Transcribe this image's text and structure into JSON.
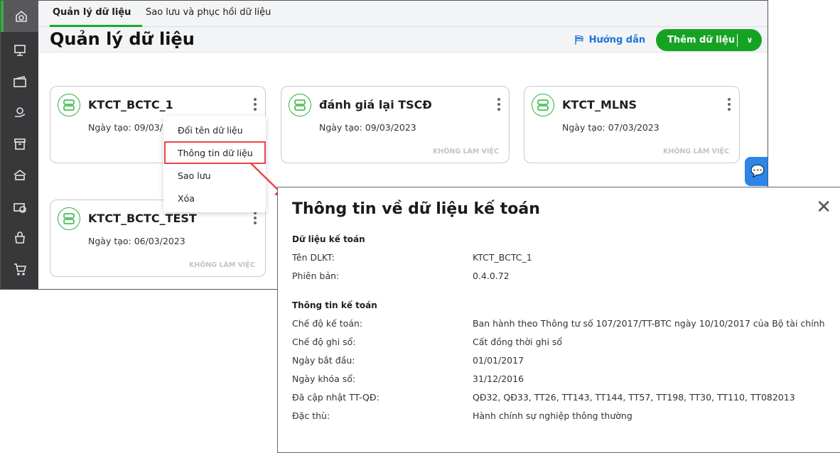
{
  "sidebar": {
    "items": [
      {
        "icon": "home-icon",
        "active": true
      },
      {
        "icon": "monitor-money-icon"
      },
      {
        "icon": "wallet-icon"
      },
      {
        "icon": "hand-money-icon"
      },
      {
        "icon": "box-icon"
      },
      {
        "icon": "car-icon"
      },
      {
        "icon": "briefcase-money-icon"
      },
      {
        "icon": "bag-icon"
      },
      {
        "icon": "cart-icon"
      }
    ]
  },
  "tabs": [
    {
      "label": "Quản lý dữ liệu",
      "active": true
    },
    {
      "label": "Sao lưu và phục hồi dữ liệu"
    }
  ],
  "header": {
    "title": "Quản lý dữ liệu",
    "guide": "Hướng dẫn",
    "add": "Thêm dữ liệu"
  },
  "cards": [
    {
      "name": "KTCT_BCTC_1",
      "date": "Ngày tạo: 09/03/2023",
      "status": ""
    },
    {
      "name": "đánh giá lại TSCĐ",
      "date": "Ngày tạo: 09/03/2023",
      "status": "KHÔNG LÀM VIỆC"
    },
    {
      "name": "KTCT_MLNS",
      "date": "Ngày tạo: 07/03/2023",
      "status": "KHÔNG LÀM VIỆC"
    },
    {
      "name": "KTCT_BCTC_TEST",
      "date": "Ngày tạo: 06/03/2023",
      "status": "KHÔNG LÀM VIỆC"
    }
  ],
  "menu": [
    "Đổi tên dữ liệu",
    "Thông tin dữ liệu",
    "Sao lưu",
    "Xóa"
  ],
  "colors": {
    "accent": "#16a323",
    "highlight": "#ee4444",
    "link": "#1e73d8",
    "sidebar": "#38383b"
  },
  "dialog": {
    "title": "Thông tin về dữ liệu kế toán",
    "sec1": "Dữ liệu kế toán",
    "rows1": [
      {
        "label": "Tên DLKT:",
        "value": "KTCT_BCTC_1"
      },
      {
        "label": "Phiên bản:",
        "value": "0.4.0.72"
      }
    ],
    "sec2": "Thông tin kế toán",
    "rows2": [
      {
        "label": "Chế độ kế toán:",
        "value": "Ban hành theo Thông tư số 107/2017/TT-BTC ngày 10/10/2017 của Bộ tài chính"
      },
      {
        "label": "Chế độ ghi sổ:",
        "value": "Cất đồng thời ghi sổ"
      },
      {
        "label": "Ngày bắt đầu:",
        "value": "01/01/2017"
      },
      {
        "label": "Ngày khóa sổ:",
        "value": "31/12/2016"
      },
      {
        "label": "Đã cập nhật TT-QĐ:",
        "value": "QĐ32, QĐ33, TT26, TT143, TT144, TT57, TT198, TT30, TT110, TT082013"
      },
      {
        "label": "Đặc thù:",
        "value": "Hành chính sự nghiệp thông thường"
      }
    ]
  }
}
